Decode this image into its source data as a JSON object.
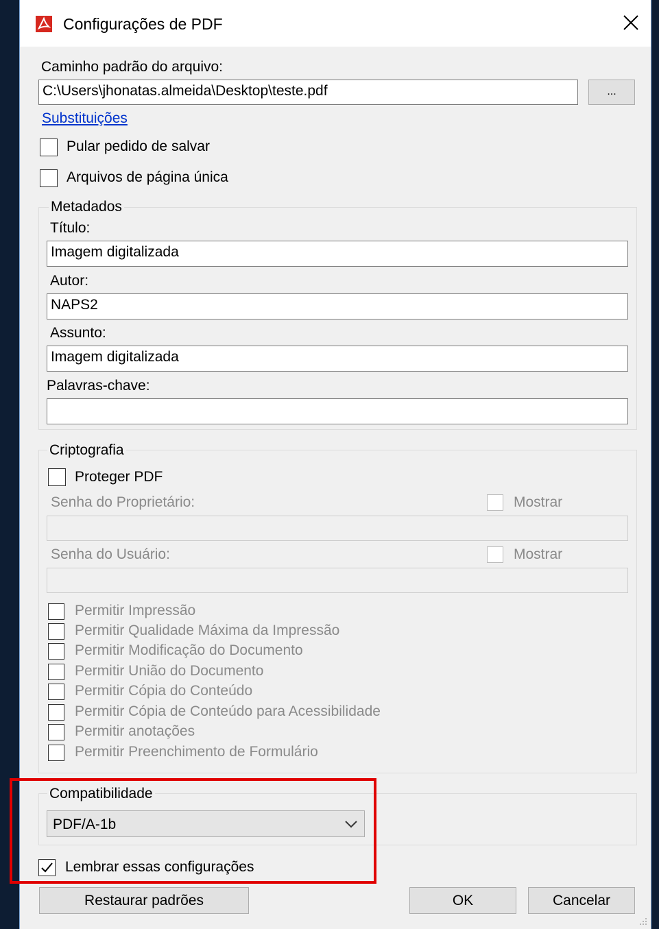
{
  "window": {
    "title": "Configurações de PDF"
  },
  "file": {
    "path_label": "Caminho padrão do arquivo:",
    "path_value": "C:\\Users\\jhonatas.almeida\\Desktop\\teste.pdf",
    "browse_label": "...",
    "substitutions_link": "Substituições",
    "skip_save_prompt": {
      "label": "Pular pedido de salvar",
      "checked": false
    },
    "single_page_files": {
      "label": "Arquivos de página única",
      "checked": false
    }
  },
  "metadata": {
    "group_title": "Metadados",
    "title_label": "Título:",
    "title_value": "Imagem digitalizada",
    "author_label": "Autor:",
    "author_value": "NAPS2",
    "subject_label": "Assunto:",
    "subject_value": "Imagem digitalizada",
    "keywords_label": "Palavras-chave:",
    "keywords_value": ""
  },
  "encryption": {
    "group_title": "Criptografia",
    "protect_pdf": {
      "label": "Proteger PDF",
      "checked": false
    },
    "owner_password_label": "Senha do Proprietário:",
    "owner_show_label": "Mostrar",
    "user_password_label": "Senha do Usuário:",
    "user_show_label": "Mostrar",
    "permissions": [
      "Permitir Impressão",
      "Permitir Qualidade Máxima da Impressão",
      "Permitir Modificação do Documento",
      "Permitir União do Documento",
      "Permitir Cópia do Conteúdo",
      "Permitir Cópia de Conteúdo para Acessibilidade",
      "Permitir anotações",
      "Permitir Preenchimento de Formulário"
    ]
  },
  "compatibility": {
    "group_title": "Compatibilidade",
    "selected": "PDF/A-1b"
  },
  "remember": {
    "label": "Lembrar essas configurações",
    "checked": true
  },
  "buttons": {
    "restore_defaults": "Restaurar padrões",
    "ok": "OK",
    "cancel": "Cancelar"
  },
  "colors": {
    "highlight": "#e00000",
    "link": "#0033cc",
    "pdf_icon": "#d6281f"
  }
}
